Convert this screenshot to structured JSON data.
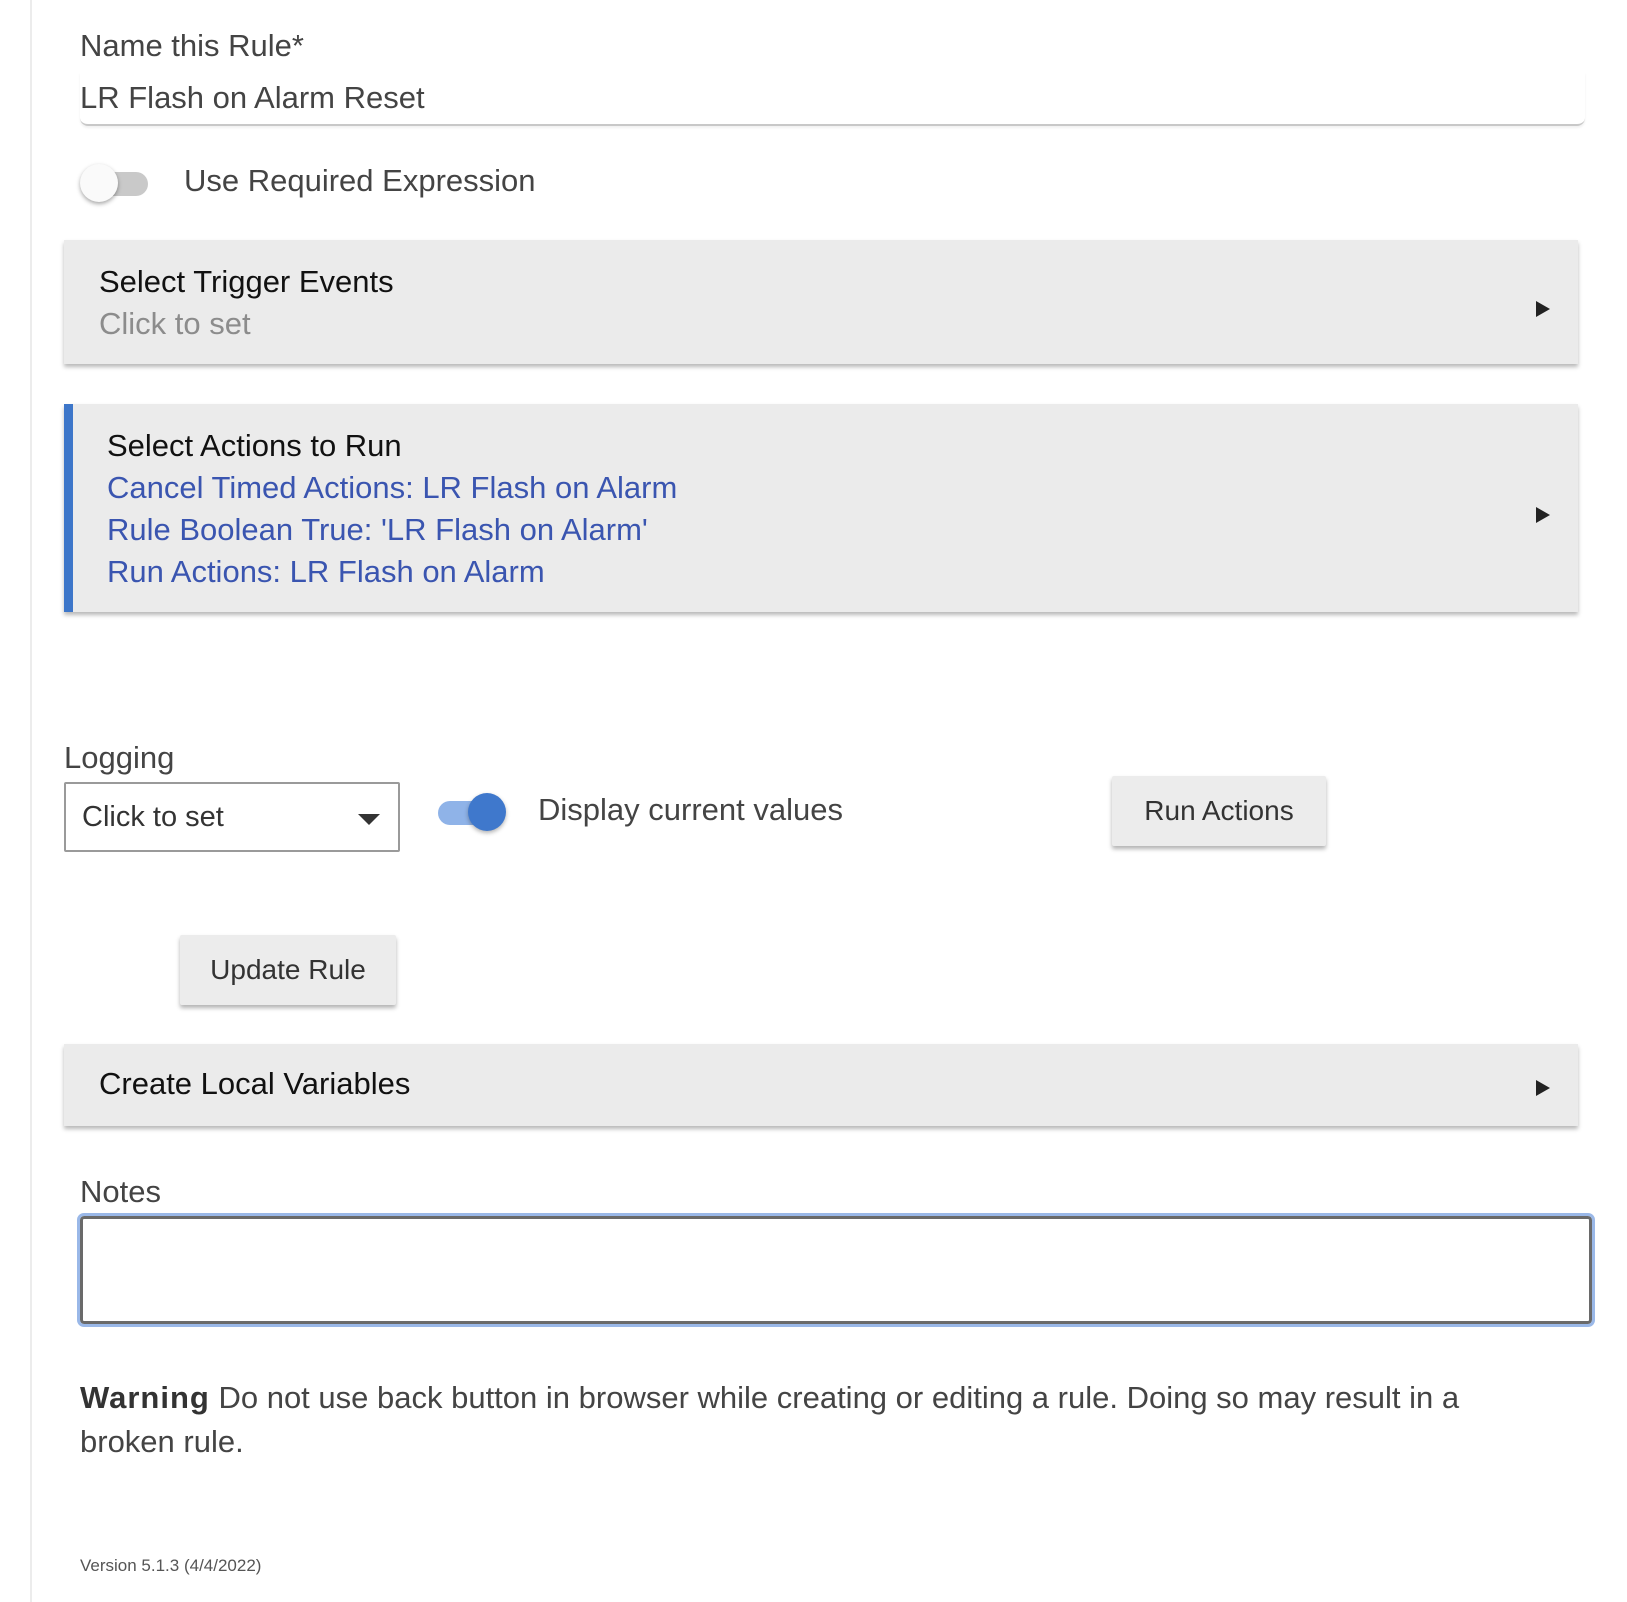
{
  "name_field": {
    "label": "Name this Rule*",
    "value": "LR Flash on Alarm Reset"
  },
  "required_expression": {
    "label": "Use Required Expression",
    "enabled": false
  },
  "trigger_panel": {
    "title": "Select Trigger Events",
    "subtitle": "Click to set"
  },
  "actions_panel": {
    "title": "Select Actions to Run",
    "items": [
      "Cancel Timed Actions: LR Flash on Alarm",
      "Rule Boolean True: 'LR Flash on Alarm'",
      "Run Actions: LR Flash on Alarm"
    ],
    "accent_color": "#3d76c9"
  },
  "logging": {
    "label": "Logging",
    "selected": "Click to set"
  },
  "display_values": {
    "label": "Display current values",
    "enabled": true
  },
  "buttons": {
    "run_actions": "Run Actions",
    "update_rule": "Update Rule"
  },
  "local_variables_panel": {
    "title": "Create Local Variables"
  },
  "notes": {
    "label": "Notes",
    "value": ""
  },
  "warning": {
    "strong": "Warning",
    "text": " Do not use back button in browser while creating or editing a rule. Doing so may result in a broken rule."
  },
  "version": "Version 5.1.3 (4/4/2022)",
  "colors": {
    "link": "#3a55b0",
    "toggle_on": "#3f78cc",
    "panel_bg": "#ebebeb"
  }
}
